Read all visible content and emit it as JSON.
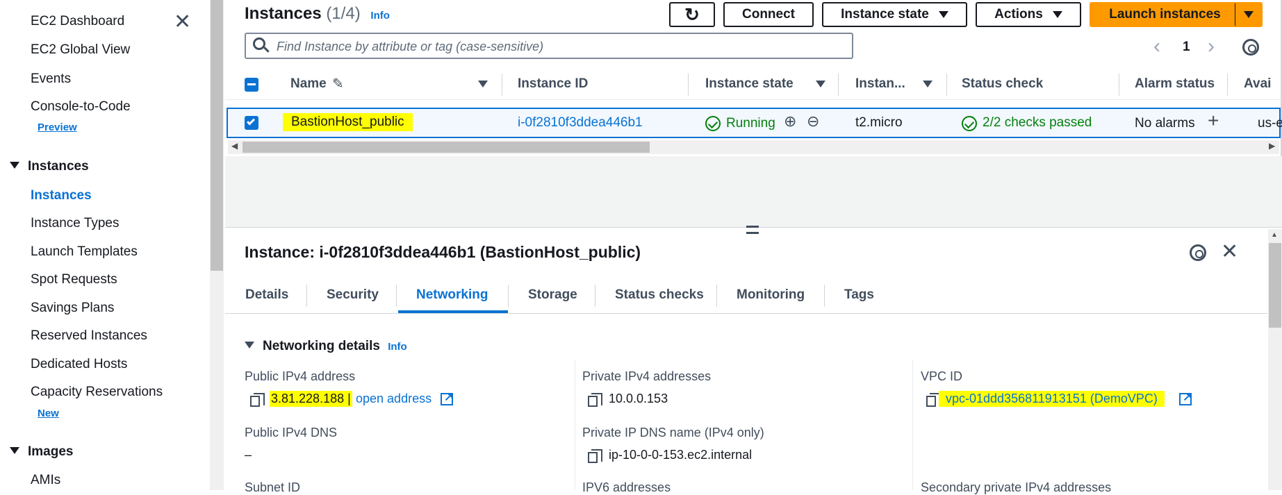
{
  "sidebar": {
    "items": [
      {
        "label": "EC2 Dashboard"
      },
      {
        "label": "EC2 Global View"
      },
      {
        "label": "Events"
      },
      {
        "label": "Console-to-Code"
      },
      {
        "badge": "Preview"
      },
      {
        "section": "Instances"
      },
      {
        "label": "Instances"
      },
      {
        "label": "Instance Types"
      },
      {
        "label": "Launch Templates"
      },
      {
        "label": "Spot Requests"
      },
      {
        "label": "Savings Plans"
      },
      {
        "label": "Reserved Instances"
      },
      {
        "label": "Dedicated Hosts"
      },
      {
        "label": "Capacity Reservations"
      },
      {
        "badge": "New"
      },
      {
        "section": "Images"
      },
      {
        "label": "AMIs"
      }
    ]
  },
  "header": {
    "title": "Instances",
    "count": "(1/4)",
    "info": "Info",
    "connect": "Connect",
    "instance_state": "Instance state",
    "actions": "Actions",
    "launch": "Launch instances"
  },
  "search": {
    "placeholder": "Find Instance by attribute or tag (case-sensitive)"
  },
  "pagination": {
    "page": "1"
  },
  "table": {
    "columns": [
      "Name",
      "Instance ID",
      "Instance state",
      "Instan...",
      "Status check",
      "Alarm status",
      "Avai"
    ],
    "row": {
      "name": "BastionHost_public",
      "id": "i-0f2810f3ddea446b1",
      "state": "Running",
      "type": "t2.micro",
      "status": "2/2 checks passed",
      "alarm": "No alarms",
      "az": "us-e"
    }
  },
  "detail": {
    "title": "Instance: i-0f2810f3ddea446b1 (BastionHost_public)",
    "tabs": [
      "Details",
      "Security",
      "Networking",
      "Storage",
      "Status checks",
      "Monitoring",
      "Tags"
    ],
    "active_tab": "Networking",
    "section": "Networking details",
    "info": "Info",
    "fields": {
      "public_ipv4_label": "Public IPv4 address",
      "public_ipv4_value": "3.81.228.188 | ",
      "open_address": "open address",
      "private_ipv4_label": "Private IPv4 addresses",
      "private_ipv4_value": "10.0.0.153",
      "vpc_label": "VPC ID",
      "vpc_value": "vpc-01ddd356811913151 (DemoVPC)",
      "public_dns_label": "Public IPv4 DNS",
      "public_dns_value": "–",
      "private_dns_label": "Private IP DNS name (IPv4 only)",
      "private_dns_value": "ip-10-0-0-153.ec2.internal",
      "subnet_label": "Subnet ID",
      "ipv6_label": "IPV6 addresses",
      "secondary_label": "Secondary private IPv4 addresses"
    }
  },
  "colors": {
    "accent": "#0972d3",
    "launch": "#ff9900",
    "success": "#037f0c",
    "highlight": "#ffff00"
  }
}
